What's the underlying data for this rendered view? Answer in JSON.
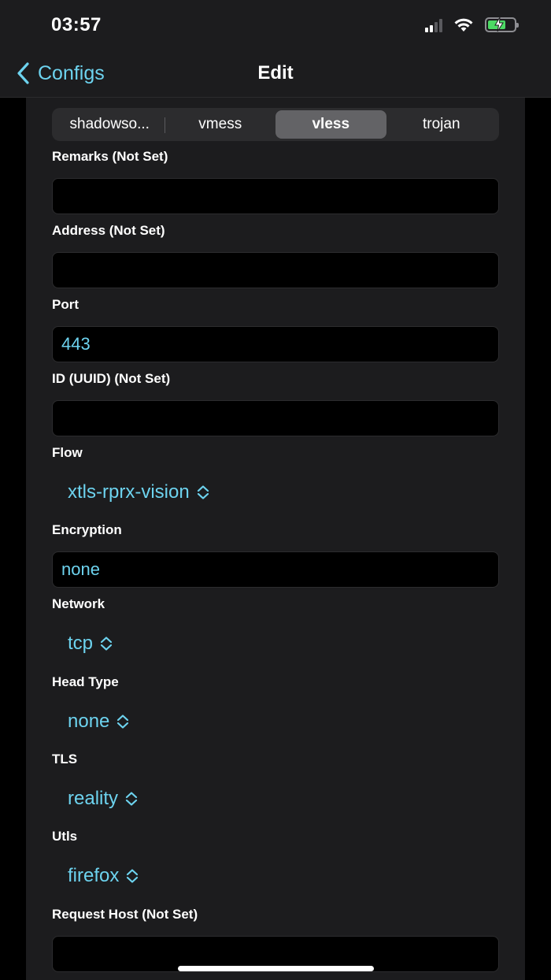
{
  "status_bar": {
    "time": "03:57"
  },
  "nav": {
    "back_label": "Configs",
    "title": "Edit"
  },
  "protocol_tabs": [
    {
      "label": "shadowso..."
    },
    {
      "label": "vmess"
    },
    {
      "label": "vless",
      "selected": true
    },
    {
      "label": "trojan"
    }
  ],
  "fields": {
    "remarks": {
      "label": "Remarks (Not Set)",
      "value": ""
    },
    "address": {
      "label": "Address (Not Set)",
      "value": ""
    },
    "port": {
      "label": "Port",
      "value": "443"
    },
    "uuid": {
      "label": "ID (UUID) (Not Set)",
      "value": ""
    },
    "flow": {
      "label": "Flow",
      "value": "xtls-rprx-vision"
    },
    "encryption": {
      "label": "Encryption",
      "value": "none"
    },
    "network": {
      "label": "Network",
      "value": "tcp"
    },
    "head_type": {
      "label": "Head Type",
      "value": "none"
    },
    "tls": {
      "label": "TLS",
      "value": "reality"
    },
    "utls": {
      "label": "Utls",
      "value": "firefox"
    },
    "request_host": {
      "label": "Request Host (Not Set)",
      "value": ""
    }
  },
  "colors": {
    "accent": "#6dd3ef",
    "background": "#1c1c1e",
    "field_bg": "#000000",
    "segment_active": "#636366"
  },
  "icons": {
    "back": "chevron-left-icon",
    "picker": "chevron-up-down-icon"
  }
}
